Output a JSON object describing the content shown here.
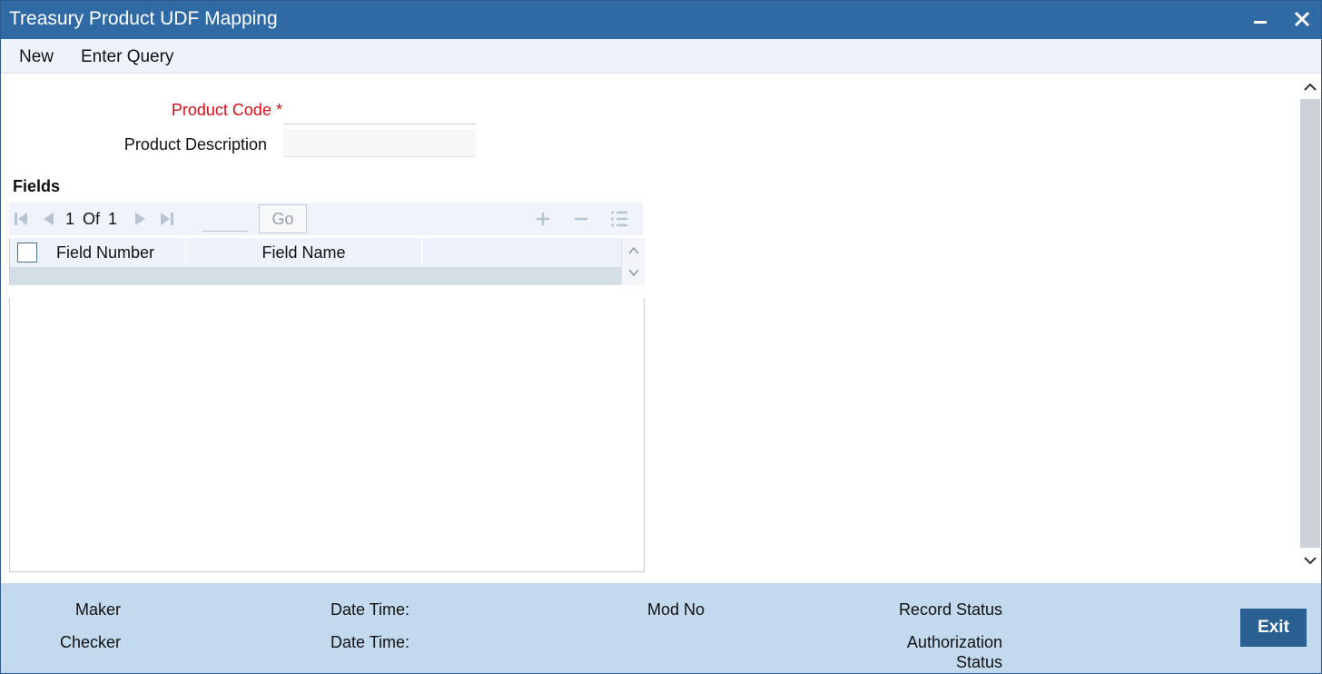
{
  "window": {
    "title": "Treasury Product UDF Mapping",
    "minimize_icon": "minimize-icon",
    "close_icon": "close-icon"
  },
  "menu": {
    "new_label": "New",
    "enter_query_label": "Enter Query"
  },
  "form": {
    "product_code_label": "Product Code",
    "required_marker": "*",
    "product_code_value": "",
    "product_description_label": "Product Description",
    "product_description_value": ""
  },
  "fields_section": {
    "title": "Fields",
    "pager": {
      "current": "1",
      "of_label": "Of",
      "total": "1",
      "go_label": "Go",
      "page_input": ""
    },
    "columns": [
      "Field Number",
      "Field Name"
    ],
    "rows": []
  },
  "footer": {
    "maker_label": "Maker",
    "checker_label": "Checker",
    "date_time_label_1": "Date Time:",
    "date_time_label_2": "Date Time:",
    "mod_no_label": "Mod No",
    "record_status_label": "Record Status",
    "auth_status_label_line1": "Authorization",
    "auth_status_label_line2": "Status",
    "exit_label": "Exit"
  },
  "colors": {
    "titlebar": "#2f6aa5",
    "required": "#d0101a",
    "footer": "#c2d9ee",
    "exit_button": "#2a5f92"
  }
}
